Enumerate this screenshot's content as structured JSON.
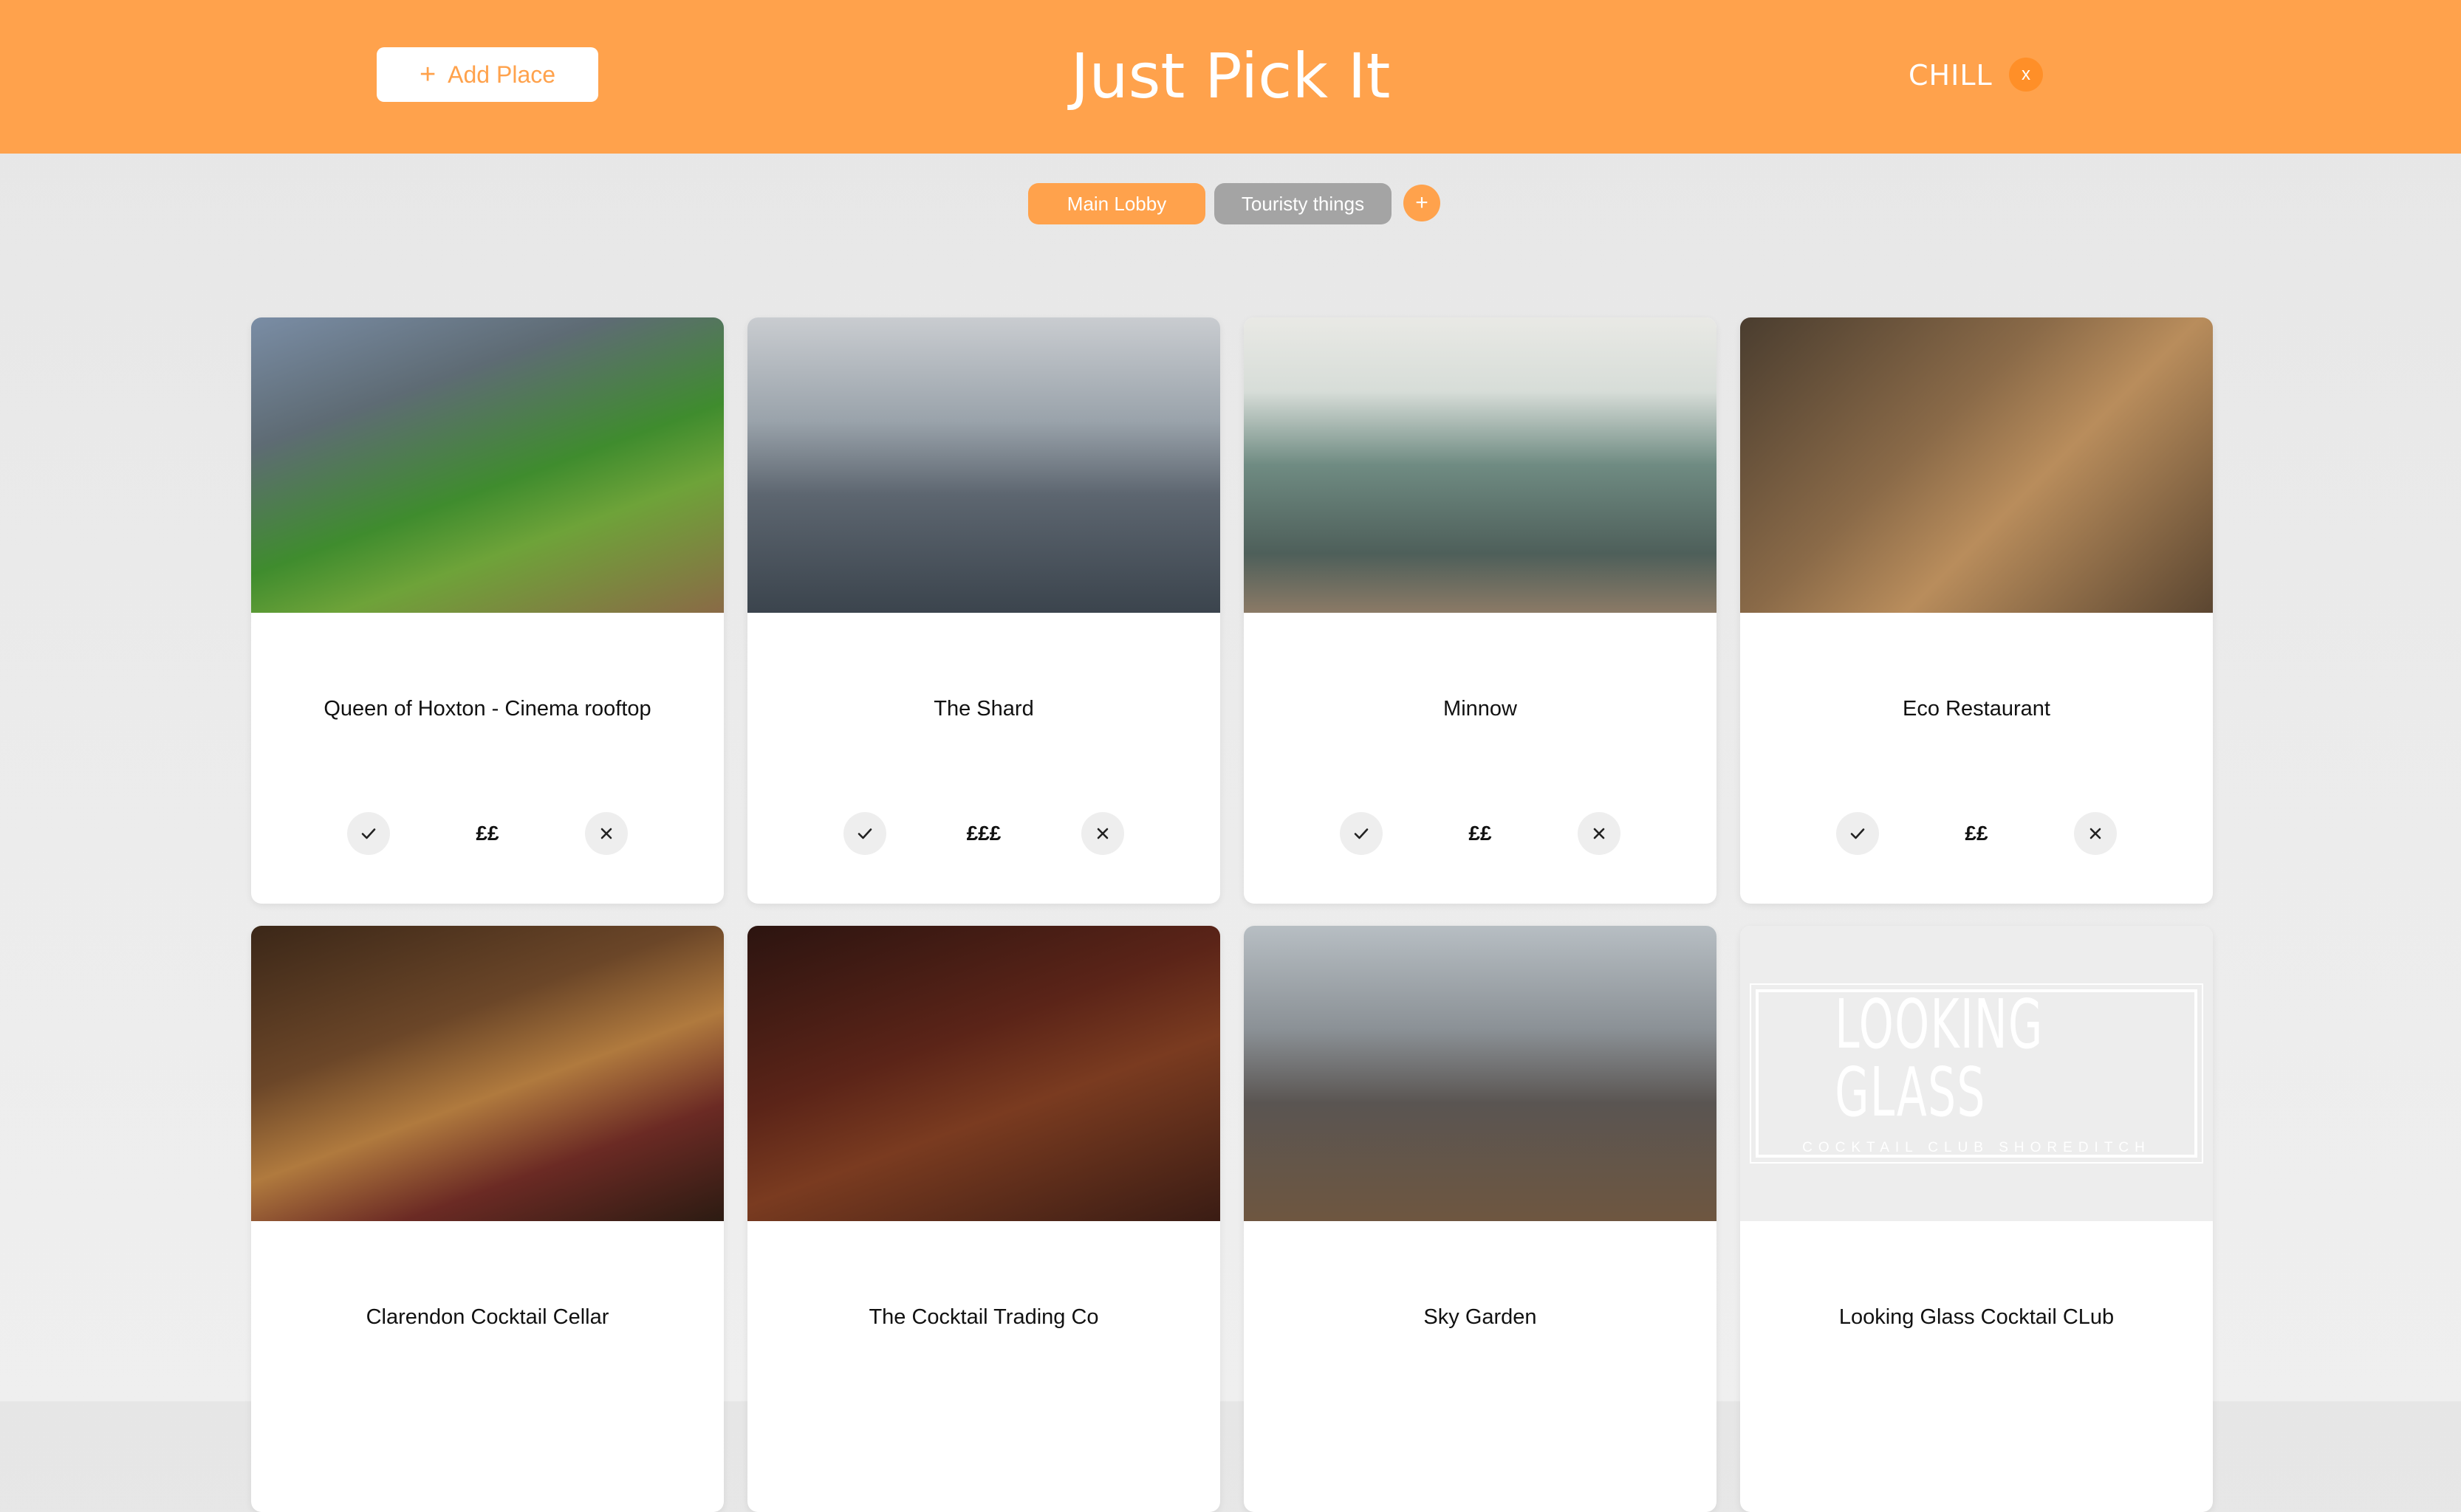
{
  "header": {
    "add_place_label": "Add Place",
    "add_place_icon": "plus-icon",
    "title": "Just Pick It",
    "mode_label": "CHILL",
    "mode_close_label": "x"
  },
  "lobbies": {
    "active_tab": "Main Lobby",
    "other_tab": "Touristy things",
    "add_label": "+"
  },
  "colors": {
    "accent": "#ffa24c",
    "inactive_tab": "#a4a4a4",
    "card_bg": "#ffffff"
  },
  "places": [
    {
      "name": "Queen of Hoxton - Cinema rooftop",
      "price": "££",
      "image": "rooftop garden bar"
    },
    {
      "name": "The Shard",
      "price": "£££",
      "image": "skyscraper over city"
    },
    {
      "name": "Minnow",
      "price": "££",
      "image": "restaurant storefront with flowers"
    },
    {
      "name": "Eco Restaurant",
      "price": "££",
      "image": "busy restaurant interior"
    },
    {
      "name": "Clarendon Cocktail Cellar",
      "price": "",
      "image": "brick cocktail bar"
    },
    {
      "name": "The Cocktail Trading Co",
      "price": "",
      "image": "dark wood cocktail bar"
    },
    {
      "name": "Sky Garden",
      "price": "",
      "image": "bright cafe interior"
    },
    {
      "name": "Looking Glass Cocktail CLub",
      "price": "",
      "image": "logo",
      "logo": {
        "title": "LOOKING GLASS",
        "subtitle": "COCKTAIL CLUB SHOREDITCH"
      }
    }
  ]
}
